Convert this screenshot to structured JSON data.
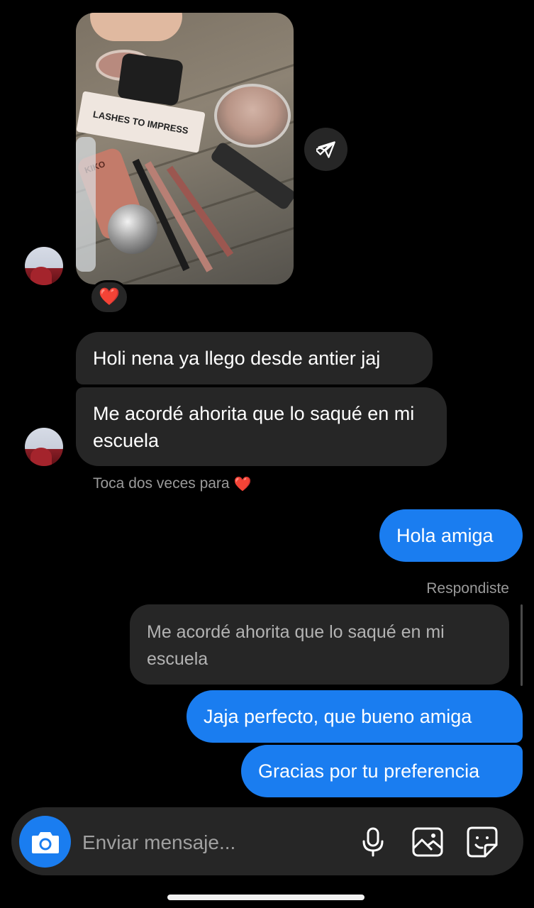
{
  "thread": {
    "media_message": {
      "image_alt": "makeup products on wooden table",
      "reaction_emoji": "❤️",
      "print_text": "LASHES TO IMPRESS",
      "brand_text": "KIKO"
    },
    "incoming": [
      {
        "text": "Holi nena ya llego desde antier jaj"
      },
      {
        "text": "Me acordé ahorita que lo saqué en mi escuela"
      }
    ],
    "hint": "Toca dos veces para",
    "hint_emoji": "❤️",
    "outgoing_first": {
      "text": "Hola amiga"
    },
    "reply_label": "Respondiste",
    "reply_quote": "Me acordé ahorita que lo saqué en mi escuela",
    "outgoing": [
      {
        "text": "Jaja perfecto, que bueno amiga"
      },
      {
        "text": "Gracias por tu preferencia"
      }
    ]
  },
  "composer": {
    "placeholder": "Enviar mensaje...",
    "icons": [
      "camera-icon",
      "microphone-icon",
      "gallery-icon",
      "sticker-icon"
    ]
  },
  "colors": {
    "background": "#000000",
    "incoming_bubble": "#262626",
    "outgoing_bubble": "#1a7df0",
    "muted_text": "#9a9a9a"
  }
}
